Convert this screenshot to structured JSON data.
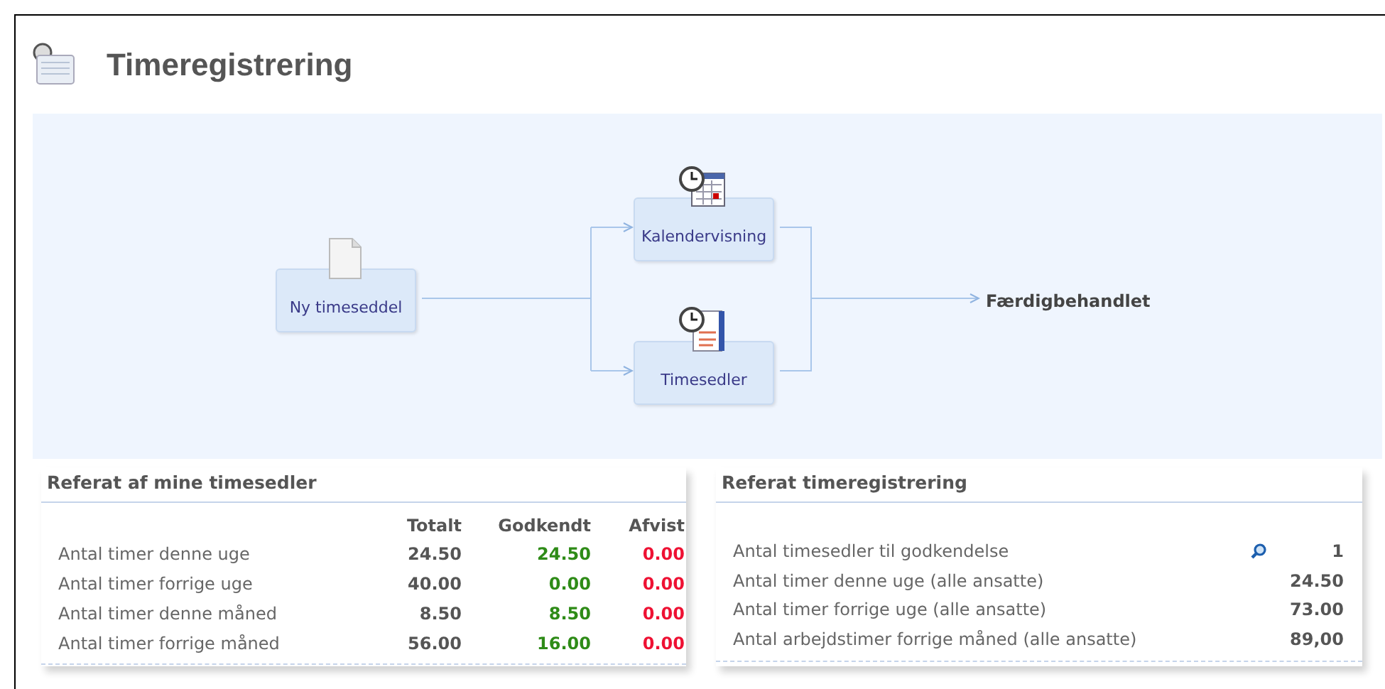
{
  "page": {
    "title": "Timeregistrering"
  },
  "flow": {
    "nodes": [
      {
        "label": "Ny timeseddel",
        "kind": "document"
      },
      {
        "label": "Kalendervisning",
        "kind": "calendar"
      },
      {
        "label": "Timesedler",
        "kind": "timesheet"
      }
    ],
    "end_label": "Færdigbehandlet"
  },
  "my_summary": {
    "title": "Referat af mine timesedler",
    "columns": [
      {
        "label": "Totalt",
        "color": "#555555"
      },
      {
        "label": "Godkendt",
        "color": "#2e8b17"
      },
      {
        "label": "Afvist",
        "color": "#ee1133"
      }
    ],
    "rows": [
      {
        "label": "Antal timer denne uge",
        "values": [
          "24.50",
          "24.50",
          "0.00"
        ]
      },
      {
        "label": "Antal timer forrige uge",
        "values": [
          "40.00",
          "0.00",
          "0.00"
        ]
      },
      {
        "label": "Antal timer denne måned",
        "values": [
          "8.50",
          "8.50",
          "0.00"
        ]
      },
      {
        "label": "Antal timer forrige måned",
        "values": [
          "56.00",
          "16.00",
          "0.00"
        ]
      }
    ]
  },
  "registration_summary": {
    "title": "Referat timeregistrering",
    "rows": [
      {
        "label": "Antal timesedler til godkendelse",
        "value": "1",
        "search": true
      },
      {
        "label": "Antal timer denne uge (alle ansatte)",
        "value": "24.50",
        "search": false
      },
      {
        "label": "Antal timer forrige uge (alle ansatte)",
        "value": "73.00",
        "search": false
      },
      {
        "label": "Antal arbejdstimer forrige måned (alle ansatte)",
        "value": "89,00",
        "search": false
      }
    ]
  }
}
